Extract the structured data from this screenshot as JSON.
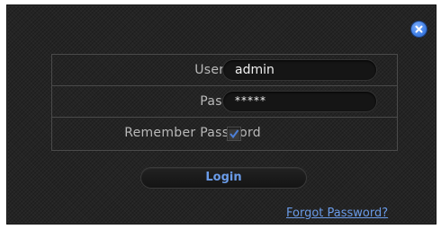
{
  "dialog": {
    "close_icon": "close-icon",
    "accent_color": "#6a9be8"
  },
  "form": {
    "username": {
      "label": "Username",
      "value": "admin"
    },
    "password": {
      "label": "Password",
      "value": "*****"
    },
    "remember": {
      "label": "Remember Password",
      "checked": true
    }
  },
  "actions": {
    "login_label": "Login",
    "forgot_label": "Forgot Password?"
  }
}
